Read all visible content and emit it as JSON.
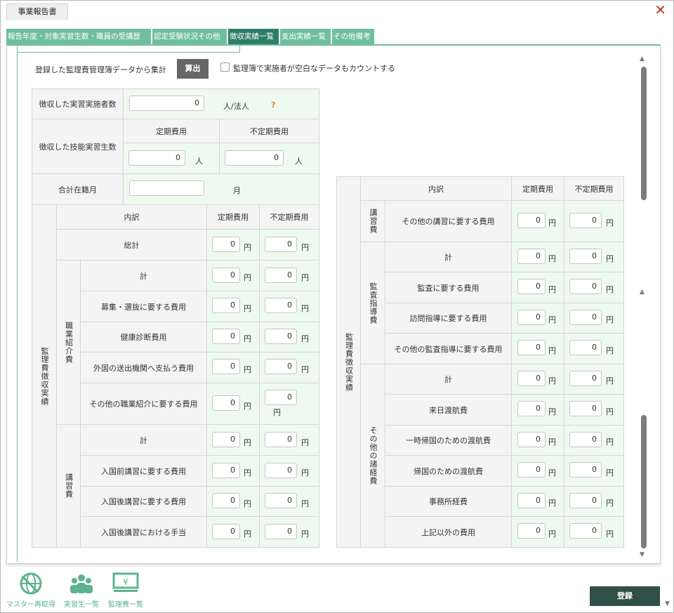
{
  "window": {
    "title": "事業報告書"
  },
  "tabs": [
    "報告年度・対象実習生数・職員の受講歴",
    "認定受験状況その他",
    "徴収実績一覧",
    "支出実績一覧",
    "その他備考"
  ],
  "toolbar": {
    "calc_text": "登録した監理費管理簿データから集計",
    "calc_button": "算出",
    "checkbox_label": "監理簿で実施者が空白なデータもカウントする"
  },
  "summary": {
    "implementers_label": "徴収した実習実施者数",
    "implementers_value": "0",
    "implementers_unit": "人/法人",
    "help": "?",
    "trainees_label": "徴収した技能実習生数",
    "regular_header": "定期費用",
    "irregular_header": "不定期費用",
    "trainees_regular": "0",
    "trainees_irregular": "0",
    "person_unit": "人",
    "months_label": "合計在籍月",
    "months_value": "",
    "months_unit": "月"
  },
  "left_table": {
    "group_label": "監理費徴収実績",
    "col_breakdown": "内訳",
    "col_regular": "定期費用",
    "col_irregular": "不定期費用",
    "total_label": "総計",
    "yen": "円",
    "sections": [
      {
        "label": "職業紹介費",
        "rows": [
          "計",
          "募集・選抜に要する費用",
          "健康診断費用",
          "外国の送出機関へ支払う費用",
          "その他の職業紹介に要する費用"
        ]
      },
      {
        "label": "講習費",
        "rows": [
          "計",
          "入国前講習に要する費用",
          "入国後講習に要する費用",
          "入国後講習における手当"
        ]
      }
    ],
    "zero": "0"
  },
  "right_table": {
    "group_label": "監理費徴収実績",
    "col_breakdown": "内訳",
    "col_regular": "定期費用",
    "col_irregular": "不定期費用",
    "sections": [
      {
        "label": "講習費",
        "rows": [
          "その他の講習に要する費用"
        ]
      },
      {
        "label": "監査指導費",
        "rows": [
          "計",
          "監査に要する費用",
          "訪問指導に要する費用",
          "その他の監査指導に要する費用"
        ]
      },
      {
        "label": "その他の諸経費",
        "rows": [
          "計",
          "来日渡航費",
          "一時帰国のための渡航費",
          "帰国のための渡航費",
          "事務所経費",
          "上記以外の費用"
        ]
      }
    ]
  },
  "bottom": {
    "master_label": "マスター再取得",
    "trainees_label": "実習生一覧",
    "fees_label": "監理費一覧",
    "submit": "登録"
  },
  "colors": {
    "accent": "#6fbf9e",
    "active_tab": "#2d7d6b",
    "cell_green": "#eefaf0",
    "submit": "#2f4f47"
  }
}
